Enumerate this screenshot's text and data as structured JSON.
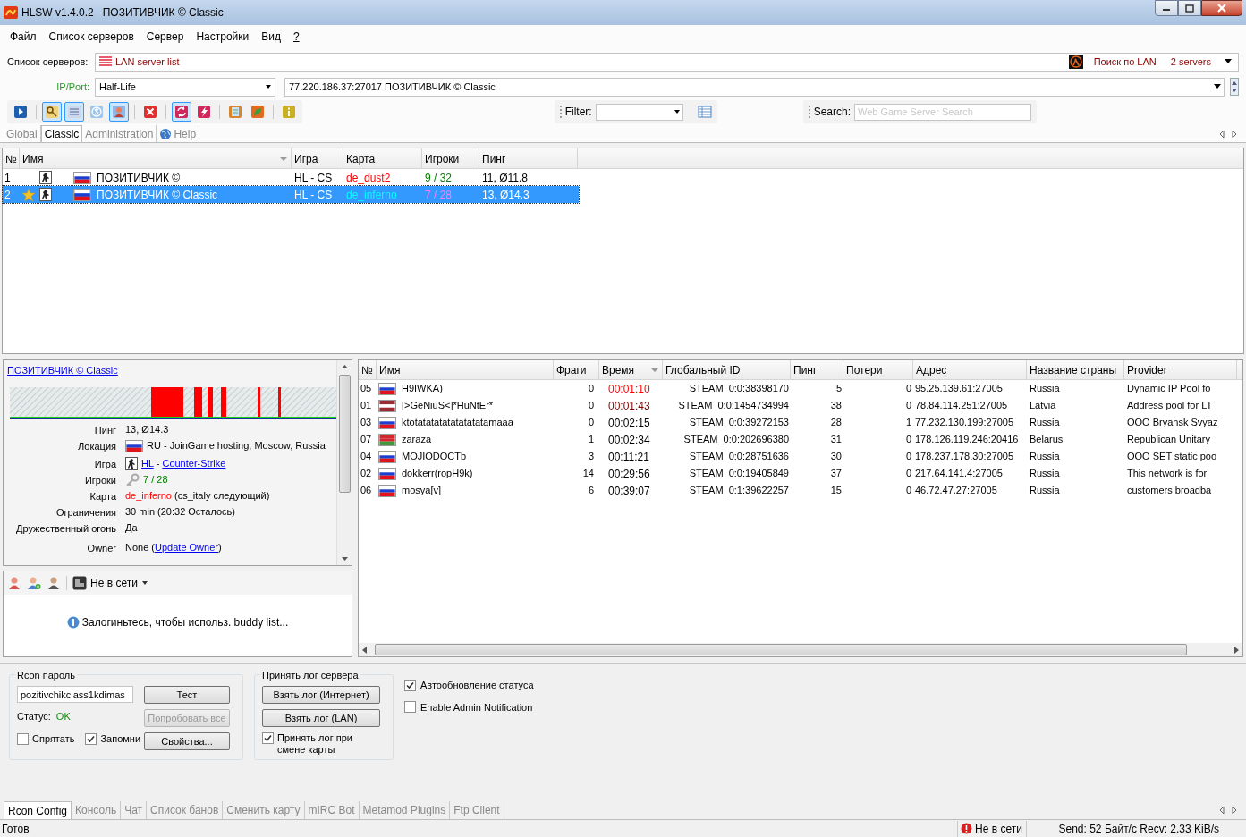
{
  "window": {
    "title": "HLSW v1.4.0.2   ПОЗИТИВЧИК © Classic"
  },
  "menu": [
    "Файл",
    "Список серверов",
    "Сервер",
    "Настройки",
    "Вид",
    "?"
  ],
  "server_list": {
    "label": "Список серверов:",
    "value": "LAN server list",
    "search_label": "Поиск по LAN",
    "count": "2 servers"
  },
  "ip_port": {
    "label": "IP/Port:",
    "game": "Half-Life",
    "address": "77.220.186.37:27017 ПОЗИТИВЧИК © Classic"
  },
  "toolbar": [
    {
      "kind": "play",
      "pressed": false,
      "sep": true
    },
    {
      "kind": "key",
      "pressed": true,
      "sep": false
    },
    {
      "kind": "list",
      "pressed": true,
      "sep": false
    },
    {
      "kind": "s",
      "pressed": false,
      "sep": false
    },
    {
      "kind": "person",
      "pressed": true,
      "sep": true
    },
    {
      "kind": "close",
      "pressed": false,
      "sep": true
    },
    {
      "kind": "refresh",
      "pressed": true,
      "sep": false
    },
    {
      "kind": "bolt",
      "pressed": false,
      "sep": true
    },
    {
      "kind": "edit",
      "pressed": false,
      "sep": false
    },
    {
      "kind": "plant",
      "pressed": false,
      "sep": true
    },
    {
      "kind": "info",
      "pressed": false,
      "sep": false
    }
  ],
  "filter": {
    "label": "Filter:"
  },
  "search": {
    "label": "Search:",
    "placeholder": "Web Game Server Search"
  },
  "view_tabs": [
    {
      "label": "Global",
      "selected": false,
      "icon": false
    },
    {
      "label": "Classic",
      "selected": true,
      "icon": false
    },
    {
      "label": "Administration",
      "selected": false,
      "icon": false
    },
    {
      "label": "Help",
      "selected": false,
      "icon": true
    }
  ],
  "server_table": {
    "columns": [
      "№",
      "Имя",
      "Игра",
      "Карта",
      "Игроки",
      "Пинг"
    ],
    "rows": [
      {
        "no": "1",
        "favorite": false,
        "name": "ПОЗИТИВЧИК ©",
        "game": "HL - CS",
        "map": "de_dust2",
        "players": "9 / 32",
        "ping": "11, Ø11.8",
        "selected": false
      },
      {
        "no": "2",
        "favorite": true,
        "name": "ПОЗИТИВЧИК © Classic",
        "game": "HL - CS",
        "map": "de_inferno",
        "players": "7 / 28",
        "ping": "13, Ø14.3",
        "selected": true
      }
    ]
  },
  "info": {
    "title": "ПОЗИТИВЧИК © Classic",
    "rows": [
      {
        "label": "Пинг",
        "kind": "none",
        "parts": [
          {
            "kind": "text",
            "text": "13, Ø14.3"
          }
        ]
      },
      {
        "label": "Локация",
        "kind": "flag",
        "parts": [
          {
            "kind": "text",
            "text": "RU - JoinGame hosting, Moscow, Russia"
          }
        ]
      },
      {
        "label": "Игра",
        "kind": "game",
        "parts": [
          {
            "kind": "link",
            "text": "HL"
          },
          {
            "kind": "text",
            "text": " - "
          },
          {
            "kind": "link",
            "text": "Counter-Strike"
          }
        ]
      },
      {
        "label": "Игроки",
        "kind": "key",
        "parts": [
          {
            "kind": "green",
            "text": "7 / 28"
          }
        ]
      },
      {
        "label": "Карта",
        "kind": "none",
        "parts": [
          {
            "kind": "red",
            "text": "de_inferno"
          },
          {
            "kind": "text",
            "text": " (cs_italy следующий)"
          }
        ]
      },
      {
        "label": "Ограничения",
        "kind": "none",
        "parts": [
          {
            "kind": "text",
            "text": "30 min (20:32 Осталось)"
          }
        ]
      },
      {
        "label": "Дружественный огонь",
        "kind": "none",
        "parts": [
          {
            "kind": "text",
            "text": "Да"
          }
        ]
      },
      {
        "label": "Owner",
        "kind": "none",
        "parts": [
          {
            "kind": "text",
            "text": "None ("
          },
          {
            "kind": "link",
            "text": "Update Owner"
          },
          {
            "kind": "text",
            "text": ")"
          }
        ]
      }
    ]
  },
  "buddy": {
    "status": "Не в сети",
    "message": "Залогиньтесь, чтобы использ. buddy list..."
  },
  "players": {
    "columns": [
      "№",
      "Имя",
      "Фраги",
      "Время",
      "Глобальный ID",
      "Пинг",
      "Потери",
      "Адрес",
      "Название страны",
      "Provider"
    ],
    "rows": [
      {
        "no": "05",
        "kind": "ru",
        "name": "H9IWKA)",
        "frags": "0",
        "time": "00:01:10",
        "color": "#ff0000",
        "id": "STEAM_0:0:38398170",
        "ping": "5",
        "loss": "0",
        "address": "95.25.139.61:27005",
        "country": "Russia",
        "provider": "Dynamic IP Pool fo"
      },
      {
        "no": "01",
        "kind": "lv",
        "name": "[>GeNiuS<]*HuNtEr*",
        "frags": "0",
        "time": "00:01:43",
        "color": "#800000",
        "id": "STEAM_0:0:1454734994",
        "ping": "38",
        "loss": "0",
        "address": "78.84.114.251:27005",
        "country": "Latvia",
        "provider": "Address pool for LT"
      },
      {
        "no": "03",
        "kind": "ru",
        "name": "ktotatatatatatatatatamaaa",
        "frags": "0",
        "time": "00:02:15",
        "color": "#000000",
        "id": "STEAM_0:0:39272153",
        "ping": "28",
        "loss": "1",
        "address": "77.232.130.199:27005",
        "country": "Russia",
        "provider": "OOO Bryansk Svyaz"
      },
      {
        "no": "07",
        "kind": "by",
        "name": "zaraza",
        "frags": "1",
        "time": "00:02:34",
        "color": "#000000",
        "id": "STEAM_0:0:202696380",
        "ping": "31",
        "loss": "0",
        "address": "178.126.119.246:20416",
        "country": "Belarus",
        "provider": "Republican Unitary"
      },
      {
        "no": "04",
        "kind": "ru",
        "name": "MOJIODOCTb",
        "frags": "3",
        "time": "00:11:21",
        "color": "#000000",
        "id": "STEAM_0:0:28751636",
        "ping": "30",
        "loss": "0",
        "address": "178.237.178.30:27005",
        "country": "Russia",
        "provider": "OOO SET static poo"
      },
      {
        "no": "02",
        "kind": "ru",
        "name": "dokkerr(ropH9k)",
        "frags": "14",
        "time": "00:29:56",
        "color": "#000000",
        "id": "STEAM_0:0:19405849",
        "ping": "37",
        "loss": "0",
        "address": "217.64.141.4:27005",
        "country": "Russia",
        "provider": "This network is for"
      },
      {
        "no": "06",
        "kind": "ru",
        "name": "mosya[v]",
        "frags": "6",
        "time": "00:39:07",
        "color": "#000000",
        "id": "STEAM_0:1:39622257",
        "ping": "15",
        "loss": "0",
        "address": "46.72.47.27:27005",
        "country": "Russia",
        "provider": "customers broadba"
      }
    ]
  },
  "rcon": {
    "label": "Rcon пароль",
    "password": "pozitivchikclass1kdimas",
    "status_label": "Статус:",
    "status_value": "OK",
    "buttons": [
      {
        "label": "Тест",
        "disabled": false
      },
      {
        "label": "Попробовать все",
        "disabled": true
      },
      {
        "label": "Свойства...",
        "disabled": false
      }
    ],
    "checkboxes": [
      {
        "label": "Спрятать",
        "checked": false
      },
      {
        "label": "Запомни",
        "checked": true
      }
    ]
  },
  "log": {
    "label": "Принять лог сервера",
    "buttons": [
      "Взять лог (Интернет)",
      "Взять лог (LAN)"
    ],
    "checkbox": {
      "label": "Принять лог при смене карты",
      "checked": true
    }
  },
  "options": [
    {
      "label": "Автообновление статуса",
      "checked": true
    },
    {
      "label": "Enable Admin Notification",
      "checked": false
    }
  ],
  "bottom_tabs": [
    {
      "label": "Rcon Config",
      "selected": true
    },
    {
      "label": "Консоль",
      "selected": false
    },
    {
      "label": "Чат",
      "selected": false
    },
    {
      "label": "Список банов",
      "selected": false
    },
    {
      "label": "Сменить карту",
      "selected": false
    },
    {
      "label": "mIRC Bot",
      "selected": false
    },
    {
      "label": "Metamod Plugins",
      "selected": false
    },
    {
      "label": "Ftp Client",
      "selected": false
    }
  ],
  "status_bar": {
    "text": "Готов",
    "connection": "Не в сети",
    "traffic": "Send: 52 Байт/с Recv: 2.33 KiB/s"
  }
}
